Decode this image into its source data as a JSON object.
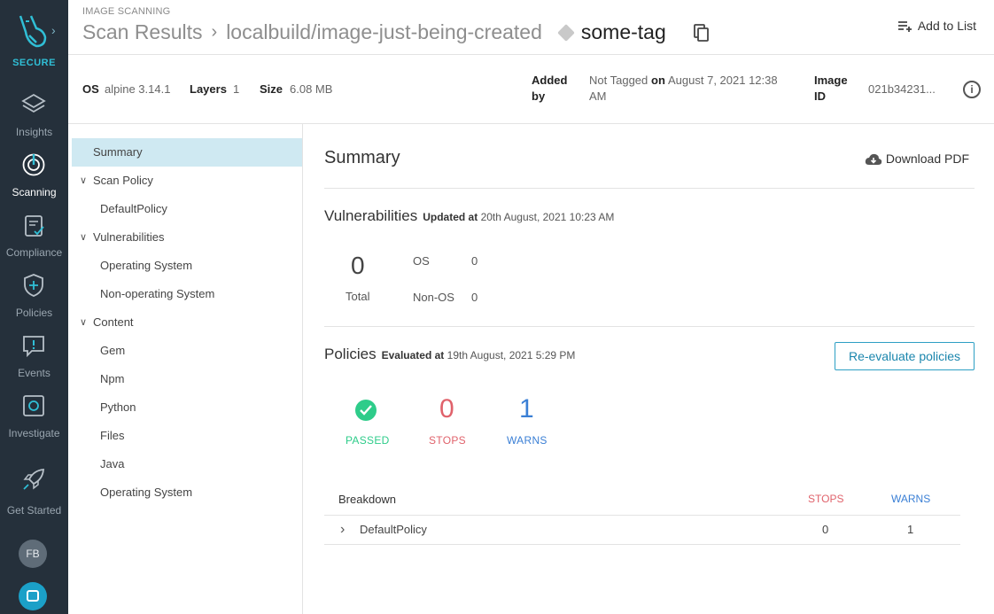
{
  "nav": {
    "brand": "SECURE",
    "items": [
      {
        "label": "Insights",
        "icon": "layers-icon"
      },
      {
        "label": "Scanning",
        "icon": "radar-icon"
      },
      {
        "label": "Compliance",
        "icon": "clipboard-check-icon"
      },
      {
        "label": "Policies",
        "icon": "shield-plus-icon"
      },
      {
        "label": "Events",
        "icon": "alert-bubble-icon"
      },
      {
        "label": "Investigate",
        "icon": "focus-icon"
      },
      {
        "label": "Get Started",
        "icon": "rocket-icon"
      }
    ],
    "avatar": "FB"
  },
  "header": {
    "section": "IMAGE SCANNING",
    "crumb_root": "Scan Results",
    "repo": "localbuild/image-just-being-created",
    "tag": "some-tag",
    "add_to_list": "Add to List"
  },
  "meta": {
    "os_label": "OS",
    "os_value": "alpine 3.14.1",
    "layers_label": "Layers",
    "layers_value": "1",
    "size_label": "Size",
    "size_value": "6.08 MB",
    "added_by_label_1": "Added",
    "added_by_label_2": "by",
    "added_by_value": "Not Tagged",
    "on_label": "on",
    "added_on_1": "August 7, 2021 12:38",
    "added_on_2": "AM",
    "image_id_label_1": "Image",
    "image_id_label_2": "ID",
    "image_id_value": "021b34231..."
  },
  "tree": [
    {
      "label": "Summary"
    },
    {
      "label": "Scan Policy"
    },
    {
      "label": "DefaultPolicy"
    },
    {
      "label": "Vulnerabilities"
    },
    {
      "label": "Operating System"
    },
    {
      "label": "Non-operating System"
    },
    {
      "label": "Content"
    },
    {
      "label": "Gem"
    },
    {
      "label": "Npm"
    },
    {
      "label": "Python"
    },
    {
      "label": "Files"
    },
    {
      "label": "Java"
    },
    {
      "label": "Operating System"
    }
  ],
  "summary": {
    "title": "Summary",
    "download": "Download PDF",
    "vuln_title": "Vulnerabilities",
    "vuln_updated_label": "Updated at",
    "vuln_updated_value": "20th August, 2021 10:23 AM",
    "total_value": "0",
    "total_label": "Total",
    "os_label": "OS",
    "os_value": "0",
    "nonos_label": "Non-OS",
    "nonos_value": "0",
    "policies_title": "Policies",
    "eval_label": "Evaluated at",
    "eval_value": "19th August, 2021 5:29 PM",
    "reevaluate": "Re-evaluate policies",
    "passed_label": "PASSED",
    "stops_value": "0",
    "stops_label": "STOPS",
    "warns_value": "1",
    "warns_label": "WARNS",
    "breakdown": {
      "col_name": "Breakdown",
      "col_stops": "STOPS",
      "col_warns": "WARNS",
      "rows": [
        {
          "name": "DefaultPolicy",
          "stops": "0",
          "warns": "1"
        }
      ]
    }
  },
  "colors": {
    "passed": "#2ecc8a",
    "stops": "#e0626b",
    "warns": "#3a7fd5",
    "accent": "#30bfd6"
  }
}
